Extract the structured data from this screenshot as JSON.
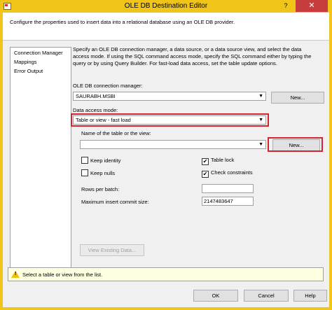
{
  "window": {
    "title": "OLE DB Destination Editor",
    "help_glyph": "?",
    "close_glyph": "✕"
  },
  "header": {
    "description": "Configure the properties used to insert data into a relational database using an OLE DB provider."
  },
  "nav": {
    "items": [
      "Connection Manager",
      "Mappings",
      "Error Output"
    ]
  },
  "main": {
    "description": "Specify an OLE DB connection manager, a data source, or a data source view, and select the data access mode. If using the SQL command access mode, specify the SQL command either by typing the query or by using Query Builder. For fast-load data access, set the table update options.",
    "connection_label": "OLE DB connection manager:",
    "connection_value": "SAURABH.MSBI",
    "connection_new": "New...",
    "access_mode_label": "Data access mode:",
    "access_mode_value": "Table or view - fast load",
    "table_label": "Name of the table or the view:",
    "table_value": "",
    "table_new": "New...",
    "keep_identity": "Keep identity",
    "keep_nulls": "Keep nulls",
    "table_lock": "Table lock",
    "check_constraints": "Check constraints",
    "check_mark": "✔",
    "rows_per_batch_label": "Rows per batch:",
    "rows_per_batch_value": "",
    "max_commit_label": "Maximum insert commit size:",
    "max_commit_value": "2147483647",
    "view_existing": "View Existing Data..."
  },
  "status": {
    "message": "Select a table or view from the list."
  },
  "footer": {
    "ok": "OK",
    "cancel": "Cancel",
    "help": "Help"
  },
  "colors": {
    "titlebar": "#f0c419",
    "highlight": "#d1262e"
  }
}
